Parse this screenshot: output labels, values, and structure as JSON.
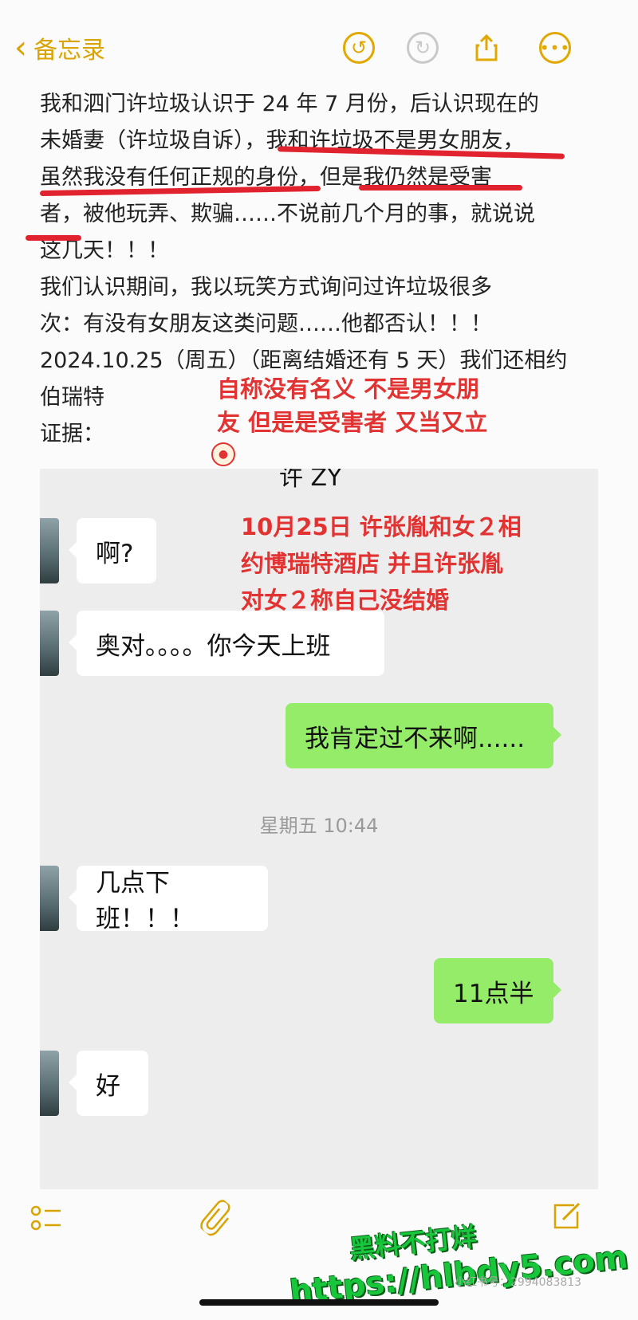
{
  "topbar": {
    "back_label": "备忘录"
  },
  "note": {
    "line1": "我和泗门许垃圾认识于 24 年 7 月份，后认识现在的",
    "line2": "未婚妻（许垃圾自诉），我和许垃圾不是男女朋友，",
    "line3": "虽然我没有任何正规的身份，但是我仍然是受害",
    "line4": "者，被他玩弄、欺骗……不说前几个月的事，就说说",
    "line5": "这几天！！！",
    "line6": "我们认识期间，我以玩笑方式询问过许垃圾很多",
    "line7": "次：有没有女朋友这类问题……他都否认！！！",
    "line8": "2024.10.25（周五）（距离结婚还有 5 天）我们还相约",
    "line9": "伯瑞特",
    "line10": "证据："
  },
  "annotation1": {
    "line1": "自称没有名义 不是男女朋",
    "line2": "友 但是是受害者 又当又立"
  },
  "chat": {
    "title": "许 ZY",
    "annotation": {
      "line1": "10月25日 许张胤和女２相",
      "line2": "约博瑞特酒店 并且许张胤",
      "line3": "对女２称自己没结婚"
    },
    "messages": [
      {
        "text": "啊?"
      },
      {
        "text": "奥对。。。。你今天上班"
      },
      {
        "text": "我肯定过不来啊......"
      },
      {
        "text": "几点下班！！！"
      },
      {
        "text": "11点半"
      },
      {
        "text": "好"
      }
    ],
    "timestamp": "星期五 10:44"
  },
  "watermark": {
    "line1": "黑料不打烊",
    "line2": "https://hlbdy5.com"
  },
  "small_id": "小红书号：2994083813",
  "colors": {
    "accent": "#e0a800",
    "annotation_red": "#e23333",
    "bubble_green": "#95ec69",
    "watermark_green": "#18c63c"
  }
}
